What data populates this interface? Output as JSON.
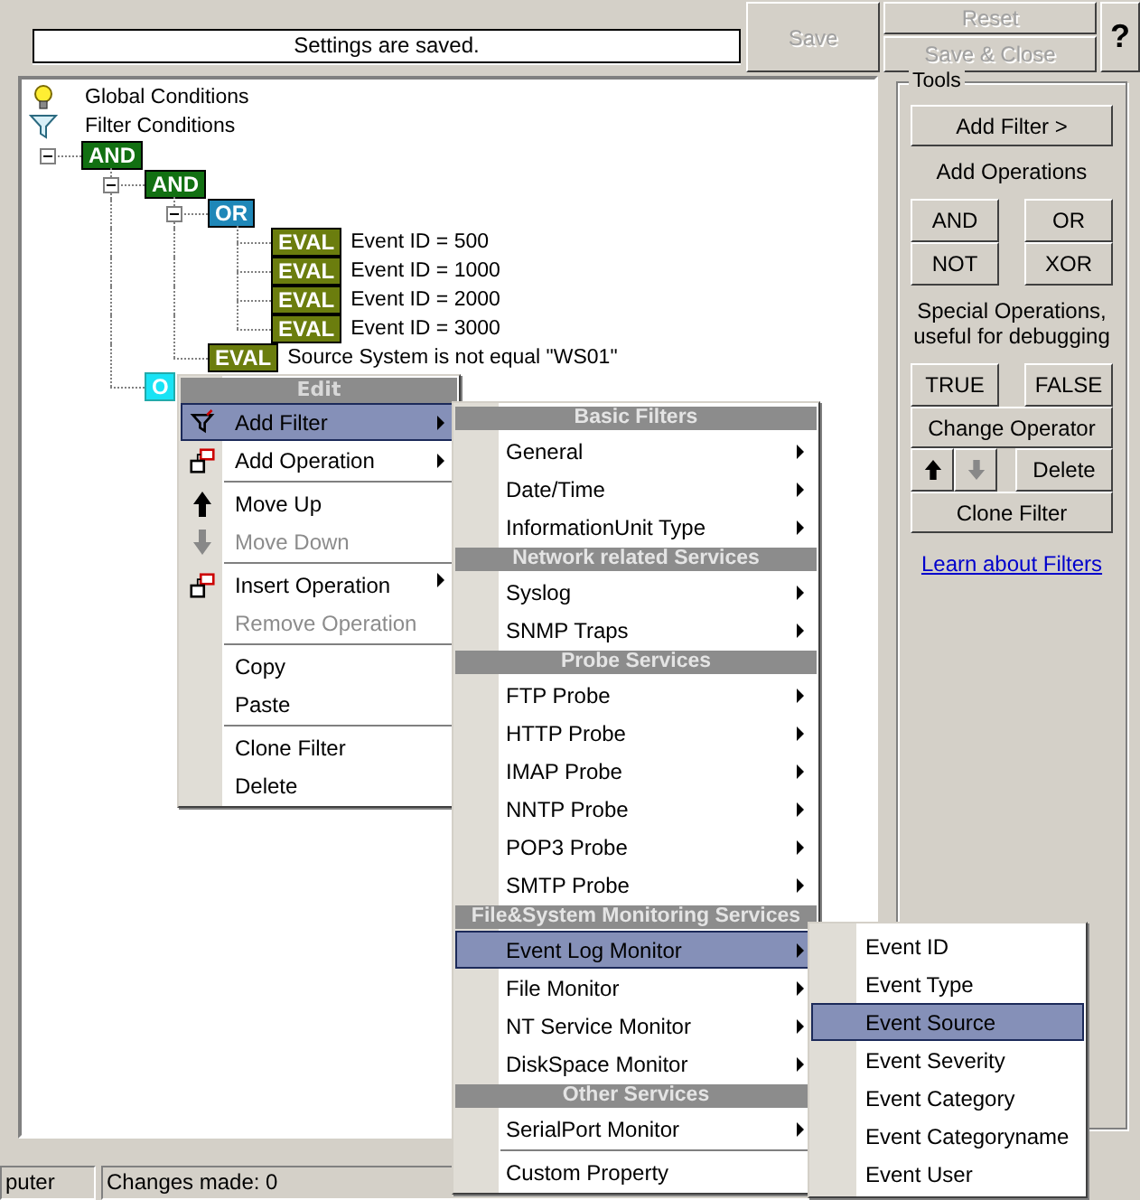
{
  "header": {
    "status_message": "Settings are saved.",
    "buttons": [
      {
        "label": "Save",
        "disabled": true,
        "kind": "save"
      },
      {
        "label": "Reset",
        "disabled": true,
        "kind": "reset"
      },
      {
        "label": "Save & Close",
        "disabled": true,
        "kind": "save-close"
      },
      {
        "label": "?",
        "disabled": false,
        "kind": "help"
      }
    ]
  },
  "tree": {
    "info_items": [
      {
        "label": "Global Conditions",
        "kind": "lightbulb"
      },
      {
        "label": "Filter Conditions",
        "kind": "filter"
      }
    ],
    "nodes": [
      {
        "kind": "and",
        "badge": "AND",
        "expanded": true,
        "selected": false,
        "children": [
          {
            "kind": "and",
            "badge": "AND",
            "expanded": true,
            "selected": false,
            "children": [
              {
                "kind": "or",
                "badge": "OR",
                "expanded": true,
                "selected": false,
                "children": [
                  {
                    "kind": "eval",
                    "badge": "EVAL",
                    "label": "Event ID = 500",
                    "selected": false
                  },
                  {
                    "kind": "eval",
                    "badge": "EVAL",
                    "label": "Event ID = 1000",
                    "selected": false
                  },
                  {
                    "kind": "eval",
                    "badge": "EVAL",
                    "label": "Event ID = 2000",
                    "selected": false
                  },
                  {
                    "kind": "eval",
                    "badge": "EVAL",
                    "label": "Event ID = 3000",
                    "selected": false
                  }
                ]
              },
              {
                "kind": "eval",
                "badge": "EVAL",
                "label": "Source System is not equal \"WS01\"",
                "selected": false
              }
            ]
          },
          {
            "kind": "or",
            "badge": "O",
            "selected": true
          }
        ]
      }
    ]
  },
  "tools": {
    "title": "Tools",
    "items": [
      {
        "kind": "button",
        "label": "Add Filter >"
      },
      {
        "kind": "caption",
        "label": "Add Operations"
      },
      {
        "kind": "pair",
        "buttons": [
          {
            "label": "AND"
          },
          {
            "label": "OR"
          }
        ]
      },
      {
        "kind": "pair",
        "buttons": [
          {
            "label": "NOT"
          },
          {
            "label": "XOR"
          }
        ]
      },
      {
        "kind": "caption",
        "label": "Special Operations, useful for debugging"
      },
      {
        "kind": "pair",
        "buttons": [
          {
            "label": "TRUE"
          },
          {
            "label": "FALSE"
          }
        ]
      },
      {
        "kind": "button",
        "label": "Change Operator"
      },
      {
        "kind": "move-delete",
        "up_disabled": false,
        "down_disabled": true,
        "label": "Delete"
      },
      {
        "kind": "button",
        "label": "Clone Filter"
      },
      {
        "kind": "link",
        "label": "Learn about Filters"
      }
    ]
  },
  "status_bar": [
    "puter",
    "Changes made: 0"
  ],
  "context_menu": {
    "title": "Edit",
    "items": [
      {
        "label": "Add Filter",
        "kind": "filter",
        "submenu": true,
        "selected": true,
        "disabled": false,
        "separator_before": false
      },
      {
        "label": "Add Operation",
        "kind": "operation",
        "submenu": true,
        "selected": false,
        "disabled": false,
        "separator_before": false
      },
      {
        "label": "Move Up",
        "kind": "up",
        "submenu": false,
        "selected": false,
        "disabled": false,
        "separator_before": true
      },
      {
        "label": "Move Down",
        "kind": "down",
        "submenu": false,
        "selected": false,
        "disabled": true,
        "separator_before": false
      },
      {
        "label": "Insert Operation",
        "kind": "operation",
        "submenu": true,
        "selected": false,
        "disabled": false,
        "separator_before": true
      },
      {
        "label": "Remove Operation",
        "submenu": false,
        "selected": false,
        "disabled": true,
        "separator_before": false
      },
      {
        "label": "Copy",
        "submenu": false,
        "selected": false,
        "disabled": false,
        "separator_before": true
      },
      {
        "label": "Paste",
        "submenu": false,
        "selected": false,
        "disabled": false,
        "separator_before": false
      },
      {
        "label": "Clone Filter",
        "submenu": false,
        "selected": false,
        "disabled": false,
        "separator_before": true
      },
      {
        "label": "Delete",
        "submenu": false,
        "selected": false,
        "disabled": false,
        "separator_before": false
      }
    ]
  },
  "filter_submenu": {
    "items": [
      {
        "kind": "header",
        "label": "Basic Filters"
      },
      {
        "kind": "item",
        "label": "General",
        "submenu": true,
        "selected": false,
        "separator_before": false
      },
      {
        "kind": "item",
        "label": "Date/Time",
        "submenu": true,
        "selected": false,
        "separator_before": false
      },
      {
        "kind": "item",
        "label": "InformationUnit Type",
        "submenu": true,
        "selected": false,
        "separator_before": false
      },
      {
        "kind": "header",
        "label": "Network related Services"
      },
      {
        "kind": "item",
        "label": "Syslog",
        "submenu": true,
        "selected": false,
        "separator_before": false
      },
      {
        "kind": "item",
        "label": "SNMP Traps",
        "submenu": true,
        "selected": false,
        "separator_before": false
      },
      {
        "kind": "header",
        "label": "Probe Services"
      },
      {
        "kind": "item",
        "label": "FTP Probe",
        "submenu": true,
        "selected": false,
        "separator_before": false
      },
      {
        "kind": "item",
        "label": "HTTP Probe",
        "submenu": true,
        "selected": false,
        "separator_before": false
      },
      {
        "kind": "item",
        "label": "IMAP Probe",
        "submenu": true,
        "selected": false,
        "separator_before": false
      },
      {
        "kind": "item",
        "label": "NNTP Probe",
        "submenu": true,
        "selected": false,
        "separator_before": false
      },
      {
        "kind": "item",
        "label": "POP3 Probe",
        "submenu": true,
        "selected": false,
        "separator_before": false
      },
      {
        "kind": "item",
        "label": "SMTP Probe",
        "submenu": true,
        "selected": false,
        "separator_before": false
      },
      {
        "kind": "header",
        "label": "File&System Monitoring Services"
      },
      {
        "kind": "item",
        "label": "Event Log Monitor",
        "submenu": true,
        "selected": true,
        "separator_before": false
      },
      {
        "kind": "item",
        "label": "File Monitor",
        "submenu": true,
        "selected": false,
        "separator_before": false
      },
      {
        "kind": "item",
        "label": "NT Service Monitor",
        "submenu": true,
        "selected": false,
        "separator_before": false
      },
      {
        "kind": "item",
        "label": "DiskSpace Monitor",
        "submenu": true,
        "selected": false,
        "separator_before": false
      },
      {
        "kind": "header",
        "label": "Other Services"
      },
      {
        "kind": "item",
        "label": "SerialPort Monitor",
        "submenu": true,
        "selected": false,
        "separator_before": false
      },
      {
        "kind": "item",
        "label": "Custom Property",
        "submenu": false,
        "selected": false,
        "separator_before": true
      }
    ]
  },
  "event_log_submenu": {
    "items": [
      {
        "label": "Event ID",
        "selected": false
      },
      {
        "label": "Event Type",
        "selected": false
      },
      {
        "label": "Event Source",
        "selected": true
      },
      {
        "label": "Event Severity",
        "selected": false
      },
      {
        "label": "Event Category",
        "selected": false
      },
      {
        "label": "Event Categoryname",
        "selected": false
      },
      {
        "label": "Event User",
        "selected": false
      }
    ]
  }
}
